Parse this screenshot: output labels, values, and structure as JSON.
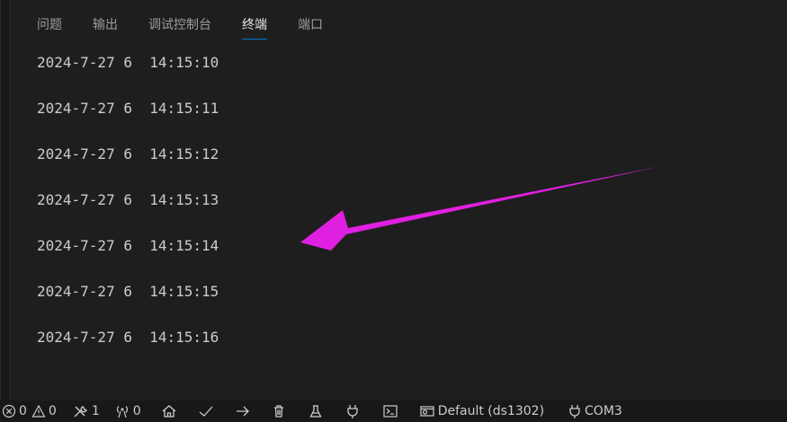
{
  "tabs": [
    {
      "label": "问题",
      "active": false
    },
    {
      "label": "输出",
      "active": false
    },
    {
      "label": "调试控制台",
      "active": false
    },
    {
      "label": "终端",
      "active": true
    },
    {
      "label": "端口",
      "active": false
    }
  ],
  "terminal": {
    "lines": [
      "2024-7-27 6  14:15:10",
      "2024-7-27 6  14:15:11",
      "2024-7-27 6  14:15:12",
      "2024-7-27 6  14:15:13",
      "2024-7-27 6  14:15:14",
      "2024-7-27 6  14:15:15",
      "2024-7-27 6  14:15:16"
    ]
  },
  "annotation": {
    "arrow_color": "#e020e0"
  },
  "statusbar": {
    "errors": "0",
    "warnings": "0",
    "tools_count": "1",
    "ports_count": "0",
    "config": "Default (ds1302)",
    "port": "COM3"
  },
  "colors": {
    "background": "#1e1e1f",
    "statusbar": "#181818",
    "text": "#cccccc",
    "active_tab_underline": "#0078d4"
  },
  "icons": {
    "errors": "error-circle-icon",
    "warnings": "warning-triangle-icon",
    "tools": "tools-icon",
    "ports": "radio-tower-icon",
    "home": "home-icon",
    "verify": "check-icon",
    "upload": "arrow-right-icon",
    "clean": "trash-icon",
    "test": "flask-icon",
    "monitor": "plug-icon",
    "terminal": "terminal-icon",
    "config": "settings-window-icon",
    "port": "plug-icon"
  }
}
